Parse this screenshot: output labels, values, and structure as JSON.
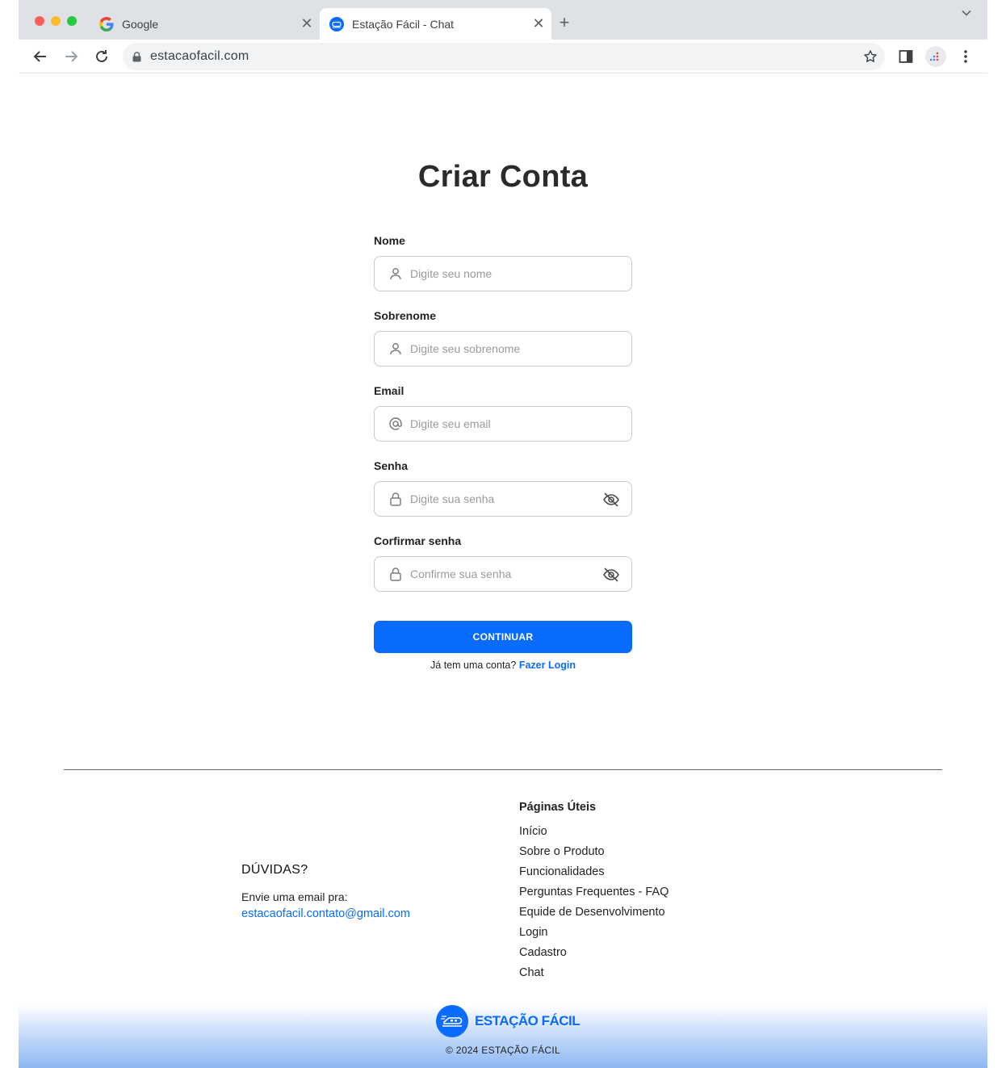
{
  "browser": {
    "tabs": [
      {
        "title": "Google",
        "icon": "google-icon",
        "active": false
      },
      {
        "title": "Estação Fácil - Chat",
        "icon": "estacao-facil-icon",
        "active": true
      }
    ],
    "close_glyph": "✕",
    "new_tab_glyph": "+",
    "url": "estacaofacil.com"
  },
  "page": {
    "title": "Criar Conta",
    "fields": [
      {
        "label": "Nome",
        "placeholder": "Digite seu nome",
        "icon": "user-icon"
      },
      {
        "label": "Sobrenome",
        "placeholder": "Digite seu sobrenome",
        "icon": "user-icon"
      },
      {
        "label": "Email",
        "placeholder": "Digite seu email",
        "icon": "at-icon"
      },
      {
        "label": "Senha",
        "placeholder": "Digite sua senha",
        "icon": "lock-icon"
      },
      {
        "label": "Corfirmar senha",
        "placeholder": "Confirme sua senha",
        "icon": "lock-icon"
      }
    ],
    "continue_label": "CONTINUAR",
    "login_prompt": "Já tem uma conta?",
    "login_link": "Fazer Login",
    "accent_color": "#0a6cff"
  },
  "footer": {
    "doubts_title": "DÚVIDAS?",
    "doubts_text": "Envie uma email pra:",
    "doubts_email": "estacaofacil.contato@gmail.com",
    "useful_title": "Páginas Úteis",
    "useful_links": [
      "Início",
      "Sobre o Produto",
      "Funcionalidades",
      "Perguntas Frequentes - FAQ",
      "Equide de Desenvolvimento",
      "Login",
      "Cadastro",
      "Chat"
    ],
    "logo_text": "ESTAÇÃO FÁCIL",
    "copyright": "© 2024 ESTAÇÃO FÁCIL"
  }
}
